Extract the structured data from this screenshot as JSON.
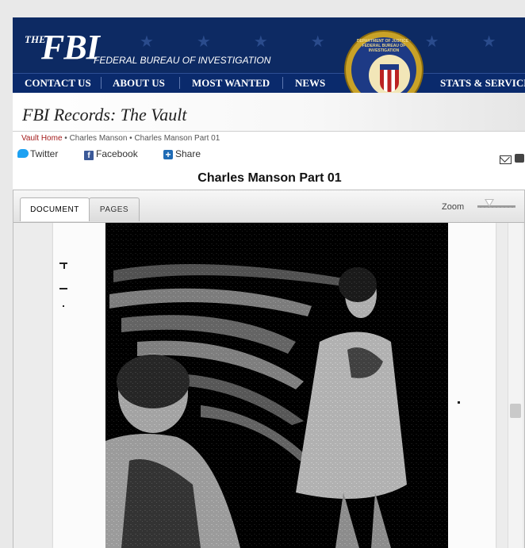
{
  "header": {
    "logo_the": "THE",
    "logo_fbi": "FBI",
    "logo_subtitle": "FEDERAL BUREAU OF INVESTIGATION",
    "seal_text": "DEPARTMENT OF JUSTICE · FEDERAL BUREAU OF INVESTIGATION",
    "nav": [
      "CONTACT US",
      "ABOUT US",
      "MOST WANTED",
      "NEWS",
      "STATS & SERVICES"
    ]
  },
  "vault": {
    "title": "FBI Records: The Vault"
  },
  "breadcrumb": {
    "home": "Vault Home",
    "sep": " • ",
    "level2": "Charles Manson",
    "level3": "Charles Manson Part 01"
  },
  "social": {
    "twitter": "Twitter",
    "facebook": "Facebook",
    "share": "Share",
    "icons": [
      "twitter-icon",
      "facebook-icon",
      "share-icon",
      "email-icon",
      "print-icon"
    ]
  },
  "document": {
    "title": "Charles Manson Part 01"
  },
  "viewer": {
    "tabs": [
      "DOCUMENT",
      "PAGES"
    ],
    "active_tab": "DOCUMENT",
    "zoom_label": "Zoom"
  },
  "colors": {
    "header_blue": "#0d2a63",
    "breadcrumb_link": "#a31c1c",
    "seal_gold": "#c9a227"
  }
}
